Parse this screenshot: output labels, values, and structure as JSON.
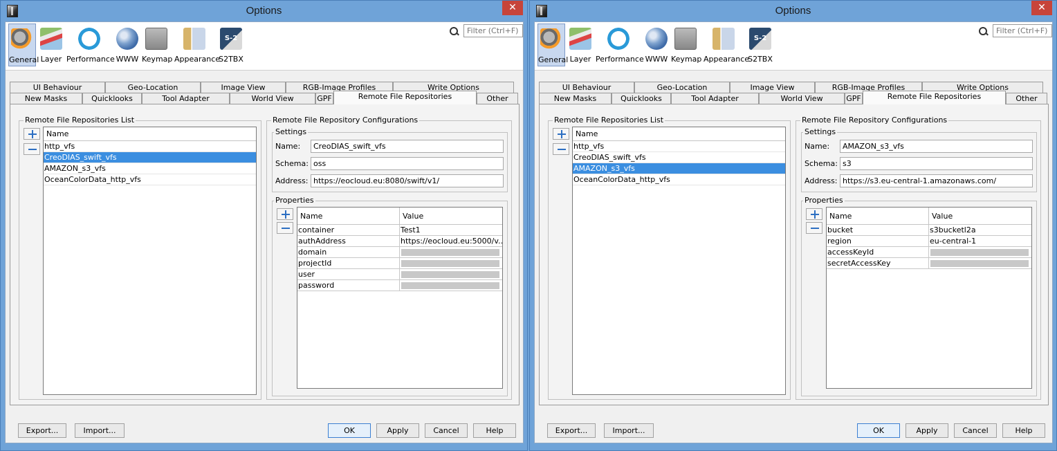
{
  "windows": [
    {
      "title": "Options",
      "close_label": "✕",
      "filter_placeholder": "Filter (Ctrl+F)",
      "toolbar": [
        {
          "label": "General",
          "icon": "general-gears-icon",
          "selected": true
        },
        {
          "label": "Layer",
          "icon": "layer-icon"
        },
        {
          "label": "Performance",
          "icon": "performance-icon"
        },
        {
          "label": "WWW",
          "icon": "globe-icon"
        },
        {
          "label": "Keymap",
          "icon": "keymap-icon"
        },
        {
          "label": "Appearance",
          "icon": "appearance-icon"
        },
        {
          "label": "S2TBX",
          "icon": "s2tbx-icon"
        }
      ],
      "tabs_top": [
        "UI Behaviour",
        "Geo-Location",
        "Image View",
        "RGB-Image Profiles",
        "Write Options"
      ],
      "tabs_bottom": [
        "New Masks",
        "Quicklooks",
        "Tool Adapter",
        "World View",
        "GPF",
        "Remote File Repositories",
        "Other"
      ],
      "active_tab": "Remote File Repositories",
      "repo_list_title": "Remote File Repositories List",
      "repo_list_header": "Name",
      "repos": [
        "http_vfs",
        "CreoDIAS_swift_vfs",
        "AMAZON_s3_vfs",
        "OceanColorData_http_vfs"
      ],
      "selected_repo_index": 1,
      "config_title": "Remote File Repository Configurations",
      "settings_title": "Settings",
      "name_label": "Name:",
      "schema_label": "Schema:",
      "address_label": "Address:",
      "name_value": "CreoDIAS_swift_vfs",
      "schema_value": "oss",
      "address_value": "https://eocloud.eu:8080/swift/v1/",
      "properties_title": "Properties",
      "prop_header_name": "Name",
      "prop_header_value": "Value",
      "properties": [
        {
          "name": "container",
          "value": "Test1",
          "masked": false
        },
        {
          "name": "authAddress",
          "value": "https://eocloud.eu:5000/v...",
          "masked": false
        },
        {
          "name": "domain",
          "value": "",
          "masked": true
        },
        {
          "name": "projectId",
          "value": "",
          "masked": true
        },
        {
          "name": "user",
          "value": "",
          "masked": true
        },
        {
          "name": "password",
          "value": "",
          "masked": true
        }
      ],
      "buttons": {
        "export": "Export...",
        "import": "Import...",
        "ok": "OK",
        "apply": "Apply",
        "cancel": "Cancel",
        "help": "Help"
      }
    },
    {
      "title": "Options",
      "close_label": "✕",
      "filter_placeholder": "Filter (Ctrl+F)",
      "toolbar": [
        {
          "label": "General",
          "icon": "general-gears-icon",
          "selected": true
        },
        {
          "label": "Layer",
          "icon": "layer-icon"
        },
        {
          "label": "Performance",
          "icon": "performance-icon"
        },
        {
          "label": "WWW",
          "icon": "globe-icon"
        },
        {
          "label": "Keymap",
          "icon": "keymap-icon"
        },
        {
          "label": "Appearance",
          "icon": "appearance-icon"
        },
        {
          "label": "S2TBX",
          "icon": "s2tbx-icon"
        }
      ],
      "tabs_top": [
        "UI Behaviour",
        "Geo-Location",
        "Image View",
        "RGB-Image Profiles",
        "Write Options"
      ],
      "tabs_bottom": [
        "New Masks",
        "Quicklooks",
        "Tool Adapter",
        "World View",
        "GPF",
        "Remote File Repositories",
        "Other"
      ],
      "active_tab": "Remote File Repositories",
      "repo_list_title": "Remote File Repositories List",
      "repo_list_header": "Name",
      "repos": [
        "http_vfs",
        "CreoDIAS_swift_vfs",
        "AMAZON_s3_vfs",
        "OceanColorData_http_vfs"
      ],
      "selected_repo_index": 2,
      "config_title": "Remote File Repository Configurations",
      "settings_title": "Settings",
      "name_label": "Name:",
      "schema_label": "Schema:",
      "address_label": "Address:",
      "name_value": "AMAZON_s3_vfs",
      "schema_value": "s3",
      "address_value": "https://s3.eu-central-1.amazonaws.com/",
      "properties_title": "Properties",
      "prop_header_name": "Name",
      "prop_header_value": "Value",
      "properties": [
        {
          "name": "bucket",
          "value": "s3bucketl2a",
          "masked": false
        },
        {
          "name": "region",
          "value": "eu-central-1",
          "masked": false
        },
        {
          "name": "accessKeyId",
          "value": "",
          "masked": true
        },
        {
          "name": "secretAccessKey",
          "value": "",
          "masked": true
        }
      ],
      "buttons": {
        "export": "Export...",
        "import": "Import...",
        "ok": "OK",
        "apply": "Apply",
        "cancel": "Cancel",
        "help": "Help"
      }
    }
  ]
}
